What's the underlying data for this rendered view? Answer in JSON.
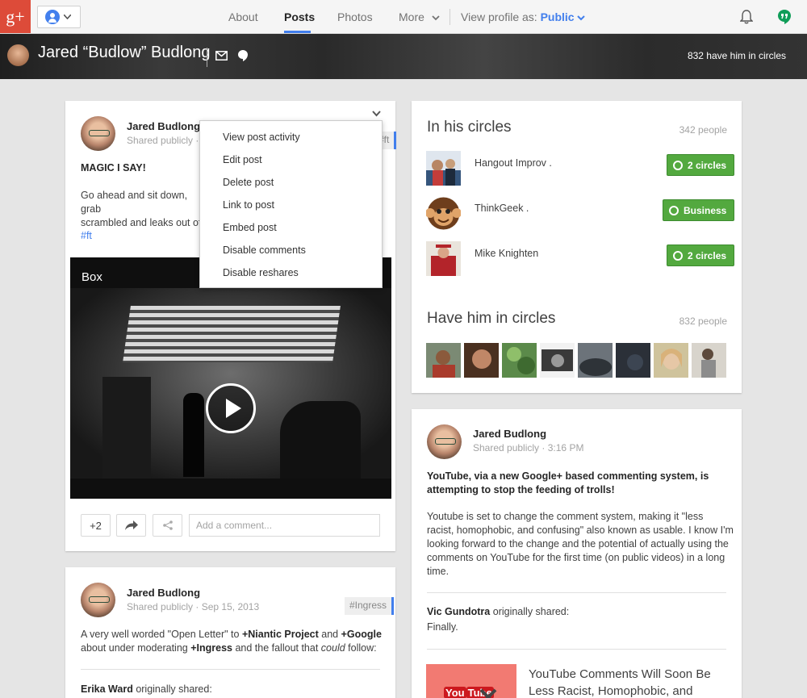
{
  "topbar": {
    "logo": "g+",
    "nav": [
      "About",
      "Posts",
      "Photos",
      "More"
    ],
    "active_tab": "Posts",
    "view_profile_label": "View profile as:",
    "view_profile_value": "Public",
    "icons": {
      "bell": "notifications-bell-icon",
      "hangouts": "hangouts-icon",
      "account": "account-switcher-icon"
    }
  },
  "profile": {
    "name": "Jared “Budlow” Budlong",
    "circles_count": "832 have him in circles"
  },
  "post1": {
    "author": "Jared Budlong",
    "visibility": "Shared publicly",
    "sep": "·",
    "tag": "#ft",
    "headline": "MAGIC I SAY!",
    "body_line1": "Go ahead and sit down, grab",
    "body_line2": "scrambled and leaks out of",
    "hashtag": "#ft",
    "video_title": "Box",
    "plus_count": "+2",
    "comment_placeholder": "Add a comment..."
  },
  "menu": {
    "items": [
      "View post activity",
      "Edit post",
      "Delete post",
      "Link to post",
      "Embed post",
      "Disable comments",
      "Disable reshares"
    ]
  },
  "post2": {
    "author": "Jared Budlong",
    "visibility": "Shared publicly",
    "sep": "·",
    "date": "Sep 15, 2013",
    "tag": "#Ingress",
    "text_a": "A very well worded \"Open Letter\" to ",
    "link_a": "+Niantic Project",
    "text_b": " and ",
    "link_b": "+Google",
    "text_c": "about under moderating ",
    "link_c": "+Ingress",
    "text_d": " and the fallout that ",
    "text_e": "could",
    "text_f": " follow:",
    "reshare_author": "Erika Ward",
    "reshare_suffix": " originally shared:"
  },
  "in_circles": {
    "title": "In his circles",
    "count": "342 people",
    "people": [
      {
        "name": "Hangout Improv .",
        "button": "2 circles"
      },
      {
        "name": "ThinkGeek .",
        "button": "Business"
      },
      {
        "name": "Mike Knighten",
        "button": "2 circles"
      }
    ]
  },
  "have_in_circles": {
    "title": "Have him in circles",
    "count": "832 people"
  },
  "post3": {
    "author": "Jared Budlong",
    "visibility": "Shared publicly",
    "sep": "·",
    "time": "3:16 PM",
    "headline_line1": "YouTube, via a new Google+ based commenting system, is",
    "headline_line2": "attempting to stop the feeding of trolls!",
    "body_line1": "Youtube is set to change the comment system, making it \"less",
    "body_line2": "racist, homophobic, and confusing\" also known as usable. I know I'm",
    "body_line3": "looking forward to the change and the potential of actually using the",
    "body_line4": "comments on YouTube for the first time (on public videos) in a long",
    "body_line5": "time.",
    "reshare_author": "Vic Gundotra",
    "reshare_suffix": " originally shared:",
    "reshare_text": "Finally.",
    "link_title": "YouTube Comments Will Soon Be Less Racist, Homophobic, and",
    "yt_logo_a": "You",
    "yt_logo_b": "Tube"
  },
  "colors": {
    "brand": "#dd4b39",
    "accent": "#427fed",
    "green": "#53a93f"
  }
}
